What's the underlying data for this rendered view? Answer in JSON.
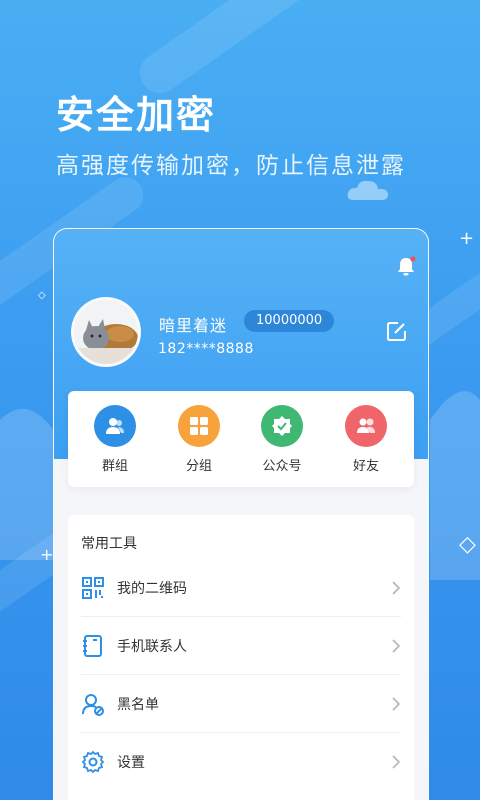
{
  "hero": {
    "title": "安全加密",
    "subtitle": "高强度传输加密，防止信息泄露"
  },
  "profile": {
    "name": "暗里着迷",
    "id": "10000000",
    "phone": "182****8888"
  },
  "quick_actions": [
    {
      "label": "群组",
      "icon": "group-icon",
      "color": "#2e8fe6"
    },
    {
      "label": "分组",
      "icon": "category-icon",
      "color": "#f7a23a"
    },
    {
      "label": "公众号",
      "icon": "official-account-icon",
      "color": "#3fb874"
    },
    {
      "label": "好友",
      "icon": "friends-icon",
      "color": "#f06569"
    }
  ],
  "tools": {
    "title": "常用工具",
    "items": [
      {
        "label": "我的二维码",
        "icon": "qrcode-icon"
      },
      {
        "label": "手机联系人",
        "icon": "contacts-book-icon"
      },
      {
        "label": "黑名单",
        "icon": "blacklist-icon"
      },
      {
        "label": "设置",
        "icon": "settings-icon"
      }
    ]
  },
  "colors": {
    "accent": "#3c9ff2",
    "id_badge": "#2e86d9",
    "notification_dot": "#ff4d4f"
  }
}
